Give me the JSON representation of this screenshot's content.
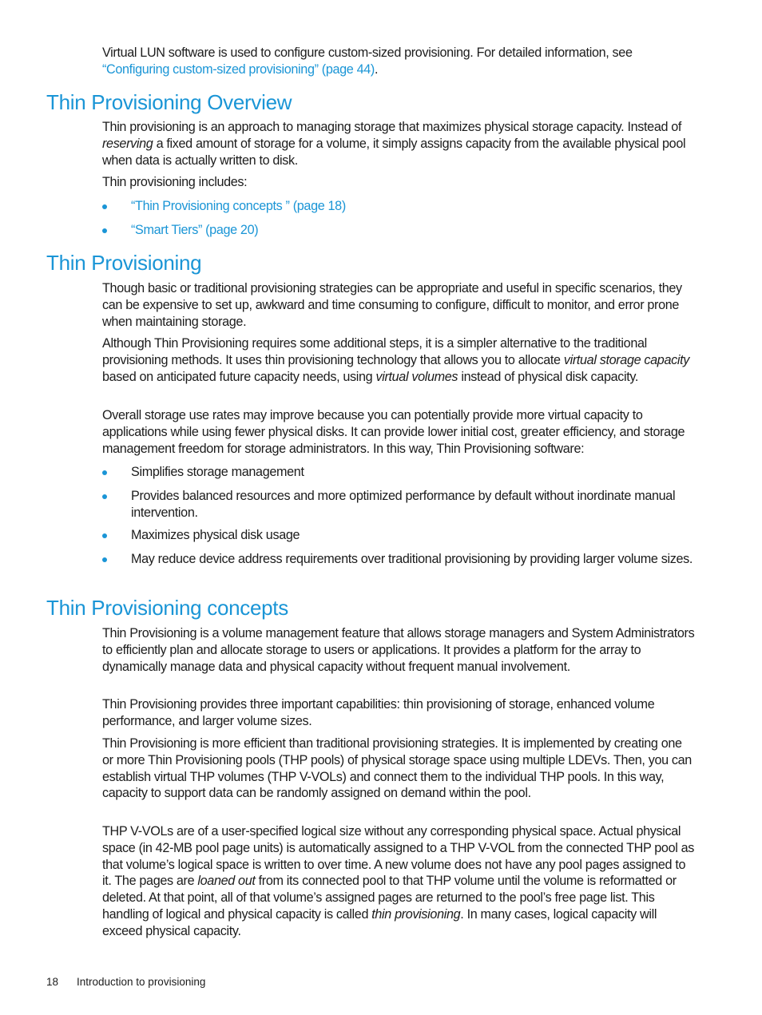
{
  "intro": {
    "text": "Virtual LUN software is used to configure custom-sized provisioning. For detailed information, see",
    "link": "“Configuring custom-sized provisioning” (page 44)",
    "after_link": "."
  },
  "sections": [
    {
      "heading": "Thin Provisioning Overview",
      "p1_a": "Thin provisioning is an approach to managing storage that maximizes physical storage capacity. Instead of ",
      "p1_em": "reserving",
      "p1_b": " a fixed amount of storage for a volume, it simply assigns capacity from the available physical pool when data is actually written to disk.",
      "p2": "Thin provisioning includes:",
      "links": [
        "“Thin Provisioning concepts ” (page 18)",
        "“Smart Tiers” (page 20)"
      ]
    },
    {
      "heading": "Thin Provisioning",
      "p1": "Though basic or traditional provisioning strategies can be appropriate and useful in specific scenarios, they can be expensive to set up, awkward and time consuming to configure, difficult to monitor, and error prone when maintaining storage.",
      "p2_a": "Although Thin Provisioning requires some additional steps, it is a simpler alternative to the traditional provisioning methods. It uses thin provisioning technology that allows you to allocate ",
      "p2_em1": "virtual storage capacity",
      "p2_b": " based on anticipated future capacity needs, using ",
      "p2_em2": "virtual volumes",
      "p2_c": " instead of physical disk capacity.",
      "p3": "Overall storage use rates may improve because you can potentially provide more virtual capacity to applications while using fewer physical disks. It can provide lower initial cost, greater efficiency, and storage management freedom for storage administrators. In this way, Thin Provisioning software:",
      "bullets": [
        "Simplifies storage management",
        "Provides balanced resources and more optimized performance by default without inordinate manual intervention.",
        "Maximizes physical disk usage",
        "May reduce device address requirements over traditional provisioning by providing larger volume sizes."
      ]
    },
    {
      "heading": "Thin Provisioning concepts",
      "p1": "Thin Provisioning is a volume management feature that allows storage managers and System Administrators to efficiently plan and allocate storage to users or applications. It provides a platform for the array to dynamically manage data and physical capacity without frequent manual involvement.",
      "p2": "Thin Provisioning provides three important capabilities: thin provisioning of storage, enhanced volume performance, and larger volume sizes.",
      "p3": "Thin Provisioning is more efficient than traditional provisioning strategies. It is implemented by creating one or more Thin Provisioning pools (THP pools) of physical storage space using multiple LDEVs. Then, you can establish virtual THP volumes (THP V-VOLs) and connect them to the individual THP pools. In this way, capacity to support data can be randomly assigned on demand within the pool.",
      "p4_a": "THP V-VOLs are of a user-specified logical size without any corresponding physical space. Actual physical space (in 42-MB pool page units) is automatically assigned to a THP V-VOL from the connected THP pool as that volume’s logical space is written to over time. A new volume does not have any pool pages assigned to it. The pages are ",
      "p4_em1": "loaned out",
      "p4_b": " from its connected pool to that THP volume until the volume is reformatted or deleted. At that point, all of that volume’s assigned pages are returned to the pool’s free page list. This handling of logical and physical capacity is called ",
      "p4_em2": "thin provisioning",
      "p4_c": ". In many cases, logical capacity will exceed physical capacity."
    }
  ],
  "footer": {
    "page_number": "18",
    "chapter": "Introduction to provisioning"
  }
}
